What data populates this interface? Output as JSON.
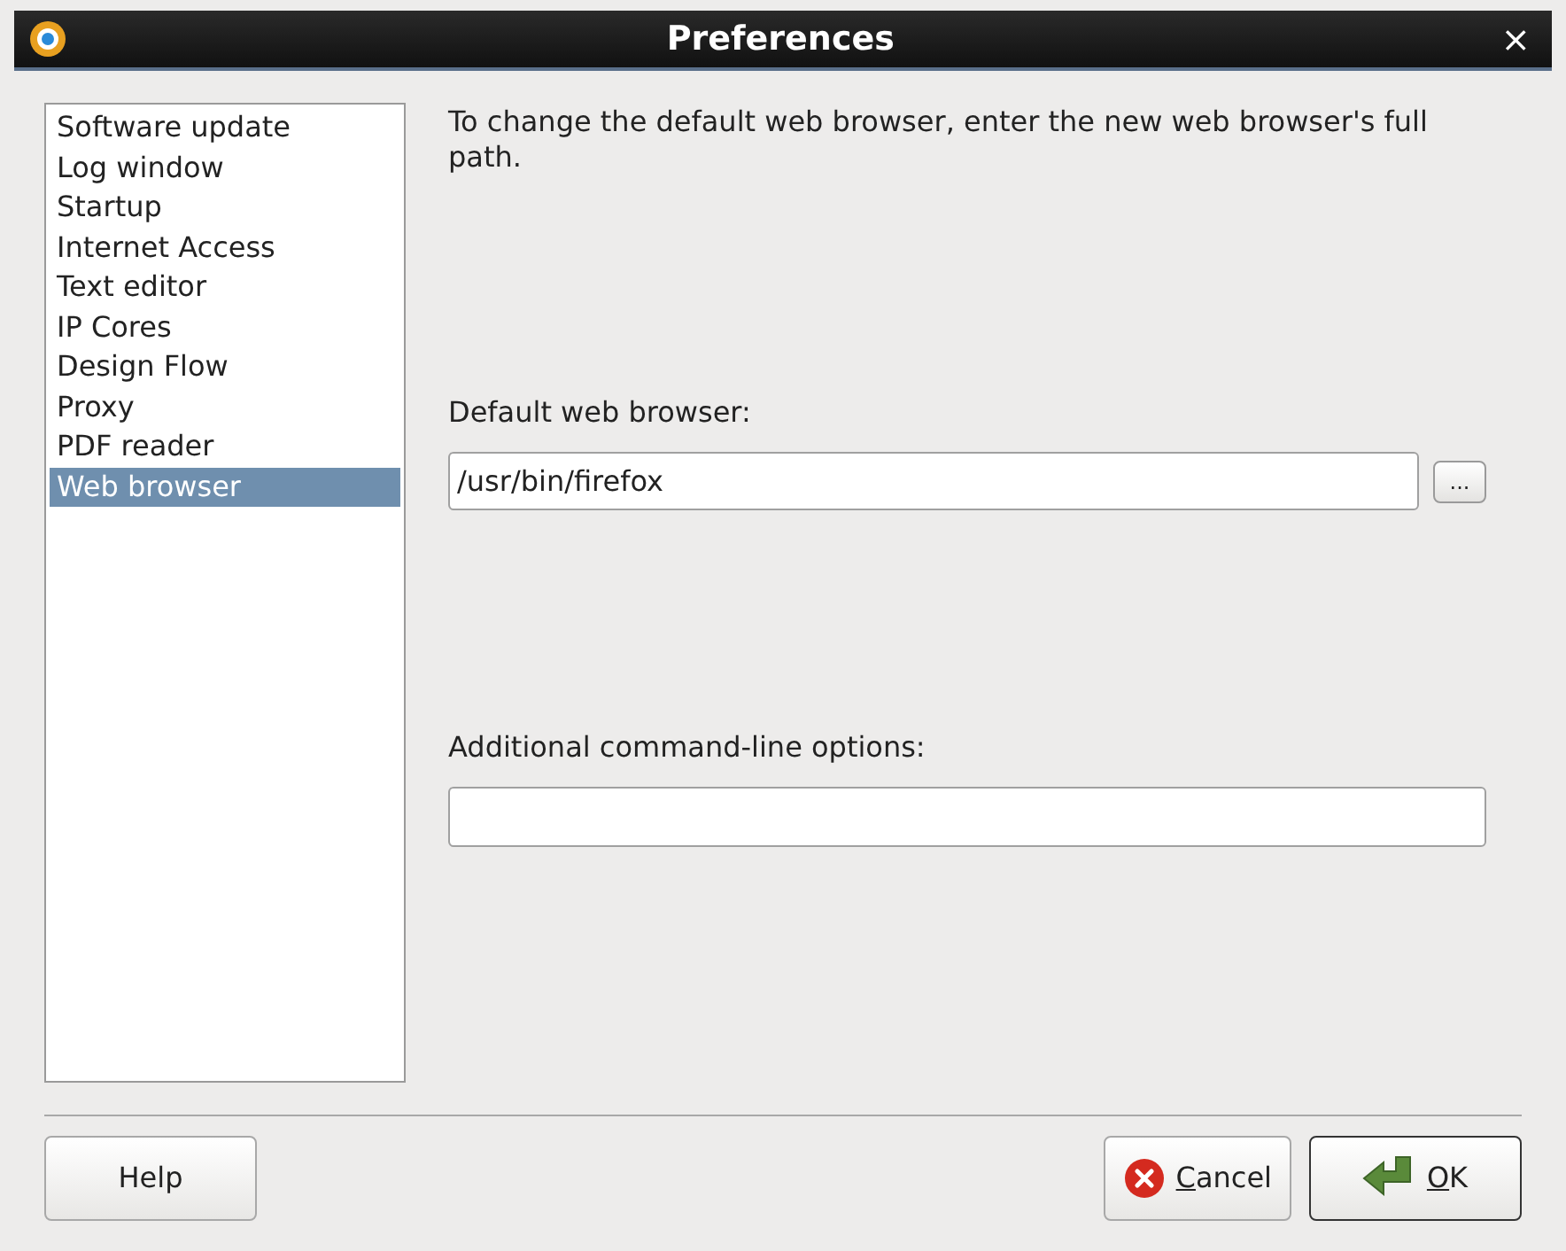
{
  "window": {
    "title": "Preferences",
    "close": "×"
  },
  "sidebar": {
    "items": [
      {
        "label": "Software update",
        "selected": false
      },
      {
        "label": "Log window",
        "selected": false
      },
      {
        "label": "Startup",
        "selected": false
      },
      {
        "label": "Internet Access",
        "selected": false
      },
      {
        "label": "Text editor",
        "selected": false
      },
      {
        "label": "IP Cores",
        "selected": false
      },
      {
        "label": "Design Flow",
        "selected": false
      },
      {
        "label": "Proxy",
        "selected": false
      },
      {
        "label": "PDF reader",
        "selected": false
      },
      {
        "label": "Web browser",
        "selected": true
      }
    ]
  },
  "content": {
    "description": "To change the default web browser, enter the new web browser's full path.",
    "browser_label": "Default web browser:",
    "browser_value": "/usr/bin/firefox",
    "browse_button": "...",
    "options_label": "Additional command-line options:"
  },
  "buttons": [
    {
      "label": "Help",
      "kind": "plain",
      "mnemonic": false
    },
    {
      "label": "Cancel",
      "kind": "cancel",
      "mnemonic": true
    },
    {
      "label": "OK",
      "kind": "ok",
      "mnemonic": true
    }
  ]
}
